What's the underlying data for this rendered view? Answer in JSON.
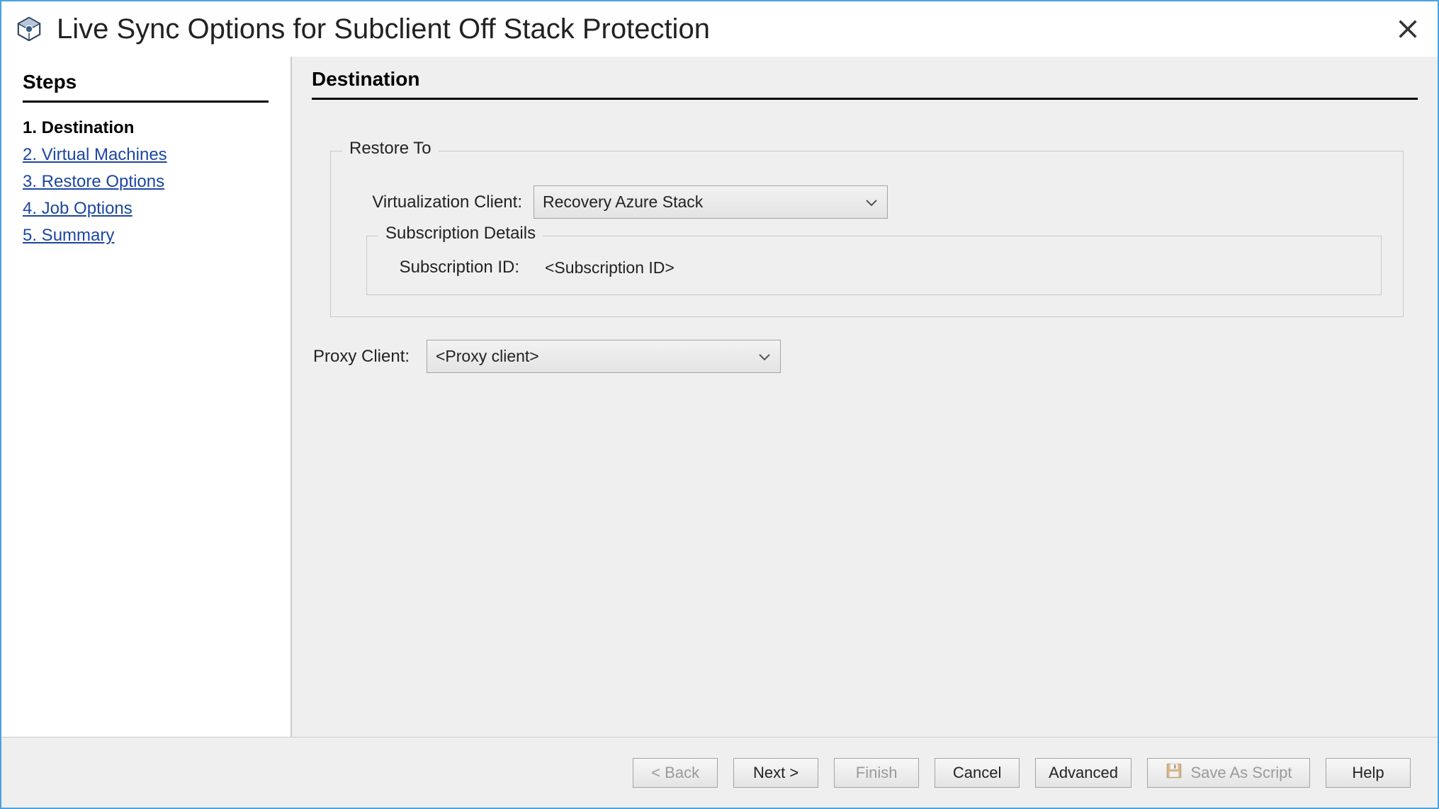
{
  "title": "Live Sync Options for Subclient Off Stack Protection",
  "sidebar": {
    "header": "Steps",
    "items": [
      {
        "label": "1. Destination",
        "current": true
      },
      {
        "label": "2. Virtual Machines",
        "current": false
      },
      {
        "label": "3. Restore Options",
        "current": false
      },
      {
        "label": "4. Job Options",
        "current": false
      },
      {
        "label": "5. Summary",
        "current": false
      }
    ]
  },
  "main": {
    "header": "Destination",
    "restore_to": {
      "legend": "Restore To",
      "virtualization_client_label": "Virtualization Client:",
      "virtualization_client_value": "Recovery Azure Stack",
      "subscription_details": {
        "legend": "Subscription Details",
        "id_label": "Subscription ID:",
        "id_value": "<Subscription ID>"
      }
    },
    "proxy_client_label": "Proxy Client:",
    "proxy_client_value": "<Proxy client>"
  },
  "footer": {
    "back": "< Back",
    "next": "Next >",
    "finish": "Finish",
    "cancel": "Cancel",
    "advanced": "Advanced",
    "save_as_script": "Save As Script",
    "help": "Help"
  }
}
